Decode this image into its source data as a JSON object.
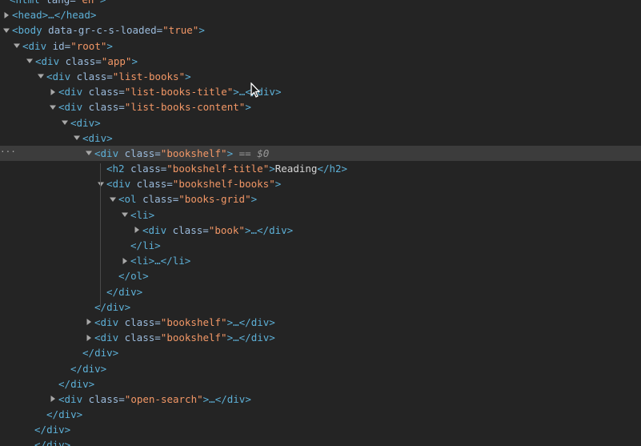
{
  "dom_tree": {
    "lines": [
      {
        "prefix": "<",
        "tag": "html",
        "attr": " lang=",
        "val": "\"en\"",
        "suffix": ">"
      },
      {
        "tri": "right",
        "prefix": "<",
        "tag": "head",
        "mid": ">…</",
        "tag2": "head",
        "suffix": ">"
      },
      {
        "tri": "down",
        "prefix": "<",
        "tag": "body",
        "attr": " data-gr-c-s-loaded=",
        "val": "\"true\"",
        "suffix": ">"
      },
      {
        "tri": "down",
        "prefix": "<",
        "tag": "div",
        "attr": " id=",
        "val": "\"root\"",
        "suffix": ">"
      },
      {
        "tri": "down",
        "prefix": "<",
        "tag": "div",
        "attr": " class=",
        "val": "\"app\"",
        "suffix": ">"
      },
      {
        "tri": "down",
        "prefix": "<",
        "tag": "div",
        "attr": " class=",
        "val": "\"list-books\"",
        "suffix": ">"
      },
      {
        "tri": "right",
        "prefix": "<",
        "tag": "div",
        "attr": " class=",
        "val": "\"list-books-title\"",
        "mid": ">…</",
        "tag2": "div",
        "suffix": ">"
      },
      {
        "tri": "down",
        "prefix": "<",
        "tag": "div",
        "attr": " class=",
        "val": "\"list-books-content\"",
        "suffix": ">"
      },
      {
        "tri": "down",
        "prefix": "<",
        "tag": "div",
        "suffix": ">"
      },
      {
        "tri": "down",
        "prefix": "<",
        "tag": "div",
        "suffix": ">"
      },
      {
        "tri": "down",
        "prefix": "<",
        "tag": "div",
        "attr": " class=",
        "val": "\"bookshelf\"",
        "suffix": ">",
        "selected": true,
        "selected_marker": " == $0"
      },
      {
        "prefix": "<",
        "tag": "h2",
        "attr": " class=",
        "val": "\"bookshelf-title\"",
        "text": "Reading",
        "close": "</h2>"
      },
      {
        "tri": "down",
        "prefix": "<",
        "tag": "div",
        "attr": " class=",
        "val": "\"bookshelf-books\"",
        "suffix": ">"
      },
      {
        "tri": "down",
        "prefix": "<",
        "tag": "ol",
        "attr": " class=",
        "val": "\"books-grid\"",
        "suffix": ">"
      },
      {
        "tri": "down",
        "prefix": "<",
        "tag": "li",
        "suffix": ">"
      },
      {
        "tri": "right",
        "prefix": "<",
        "tag": "div",
        "attr": " class=",
        "val": "\"book\"",
        "mid": ">…</",
        "tag2": "div",
        "suffix": ">"
      },
      {
        "prefix": "</",
        "tag": "li",
        "suffix": ">"
      },
      {
        "tri": "right",
        "prefix": "<",
        "tag": "li",
        "mid": ">…</",
        "tag2": "li",
        "suffix": ">"
      },
      {
        "prefix": "</",
        "tag": "ol",
        "suffix": ">"
      },
      {
        "prefix": "</",
        "tag": "div",
        "suffix": ">"
      },
      {
        "prefix": "</",
        "tag": "div",
        "suffix": ">"
      },
      {
        "tri": "right",
        "prefix": "<",
        "tag": "div",
        "attr": " class=",
        "val": "\"bookshelf\"",
        "mid": ">…</",
        "tag2": "div",
        "suffix": ">"
      },
      {
        "tri": "right",
        "prefix": "<",
        "tag": "div",
        "attr": " class=",
        "val": "\"bookshelf\"",
        "mid": ">…</",
        "tag2": "div",
        "suffix": ">"
      },
      {
        "prefix": "</",
        "tag": "div",
        "suffix": ">"
      },
      {
        "prefix": "</",
        "tag": "div",
        "suffix": ">"
      },
      {
        "prefix": "</",
        "tag": "div",
        "suffix": ">"
      },
      {
        "tri": "right",
        "prefix": "<",
        "tag": "div",
        "attr": " class=",
        "val": "\"open-search\"",
        "mid": ">…</",
        "tag2": "div",
        "suffix": ">"
      },
      {
        "prefix": "</",
        "tag": "div",
        "suffix": ">"
      },
      {
        "prefix": "</",
        "tag": "div",
        "suffix": ">"
      },
      {
        "prefix": "</",
        "tag": "div",
        "suffix": ">"
      }
    ]
  },
  "colors": {
    "background": "#242424",
    "selected_row": "#3c3c3c",
    "tag": "#5db0d7",
    "attribute": "#9bbbdc",
    "value": "#f29766",
    "text": "#d5d5d5"
  },
  "icons": {
    "expanded": "triangle-down-icon",
    "collapsed": "triangle-right-icon",
    "more": "ellipsis-icon",
    "pointer": "mouse-cursor-icon"
  }
}
